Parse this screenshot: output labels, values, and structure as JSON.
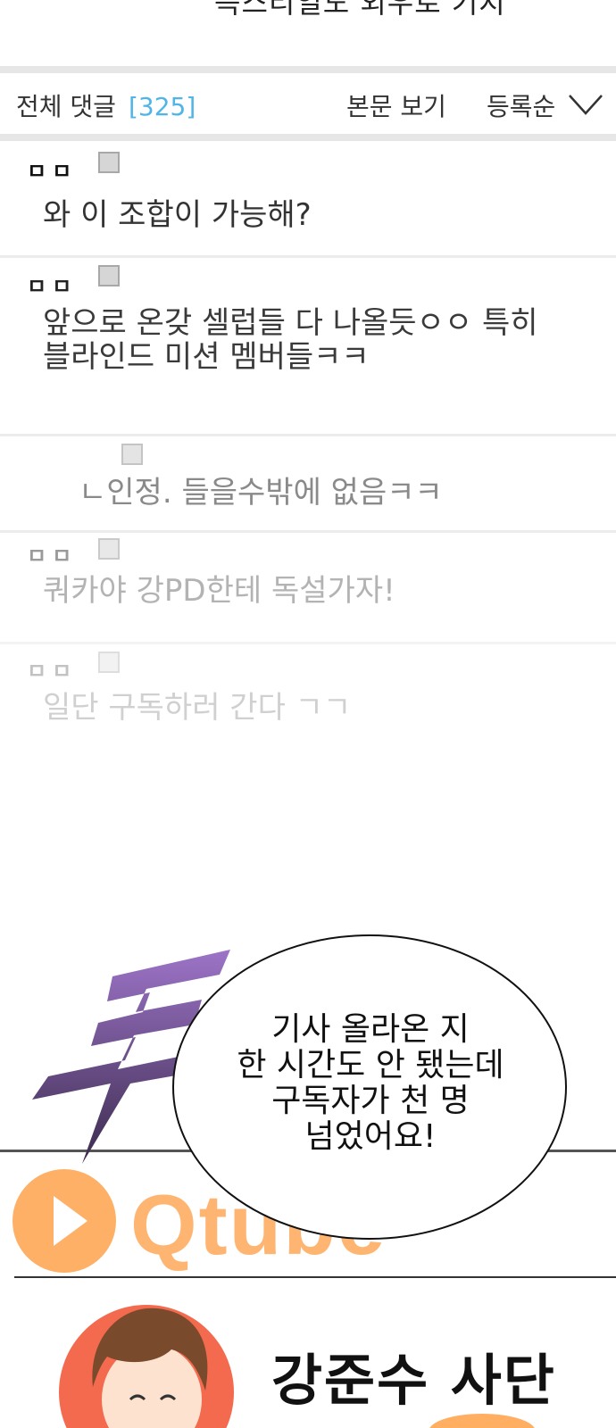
{
  "top": {
    "cut_title": "득스티일도 외우로 기지"
  },
  "header": {
    "all_comments_label": "전체 댓글",
    "comment_count": "[325]",
    "view_body_label": "본문 보기",
    "sort_label": "등록순"
  },
  "comments": [
    {
      "author": "ㅁㅁ",
      "text_lines": [
        "와 이 조합이 가능해?"
      ]
    },
    {
      "author": "ㅁㅁ",
      "text_lines": [
        "앞으로 온갖 셀럽들 다 나올듯ㅇㅇ 특히",
        "블라인드 미션 멤버들ㅋㅋ"
      ]
    },
    {
      "author": "",
      "text_lines": [
        "ㄴ인정. 들을수밖에 없음ㅋㅋ"
      ]
    },
    {
      "author": "ㅁㅁ",
      "text_lines": [
        "쿼카야 강PD한테 독설가자!"
      ]
    },
    {
      "author": "ㅁㅁ",
      "text_lines": [
        "일단 구독하러 간다 ㄱㄱ"
      ]
    }
  ],
  "bubble": {
    "lines": [
      "기사 올라온 지",
      "한 시간도 안 됐는데",
      "구독자가 천 명",
      "넘었어요!"
    ]
  },
  "sfx": {
    "icon": "sfx-du-icon"
  },
  "channel": {
    "logo_text": "Qtube",
    "name": "강준수 사단"
  },
  "colors": {
    "count_blue": "#4fb5e8",
    "qtube_orange": "#ffb572",
    "sfx_purple": "#8a5fb0",
    "avatar_bg": "#f46a4f"
  }
}
